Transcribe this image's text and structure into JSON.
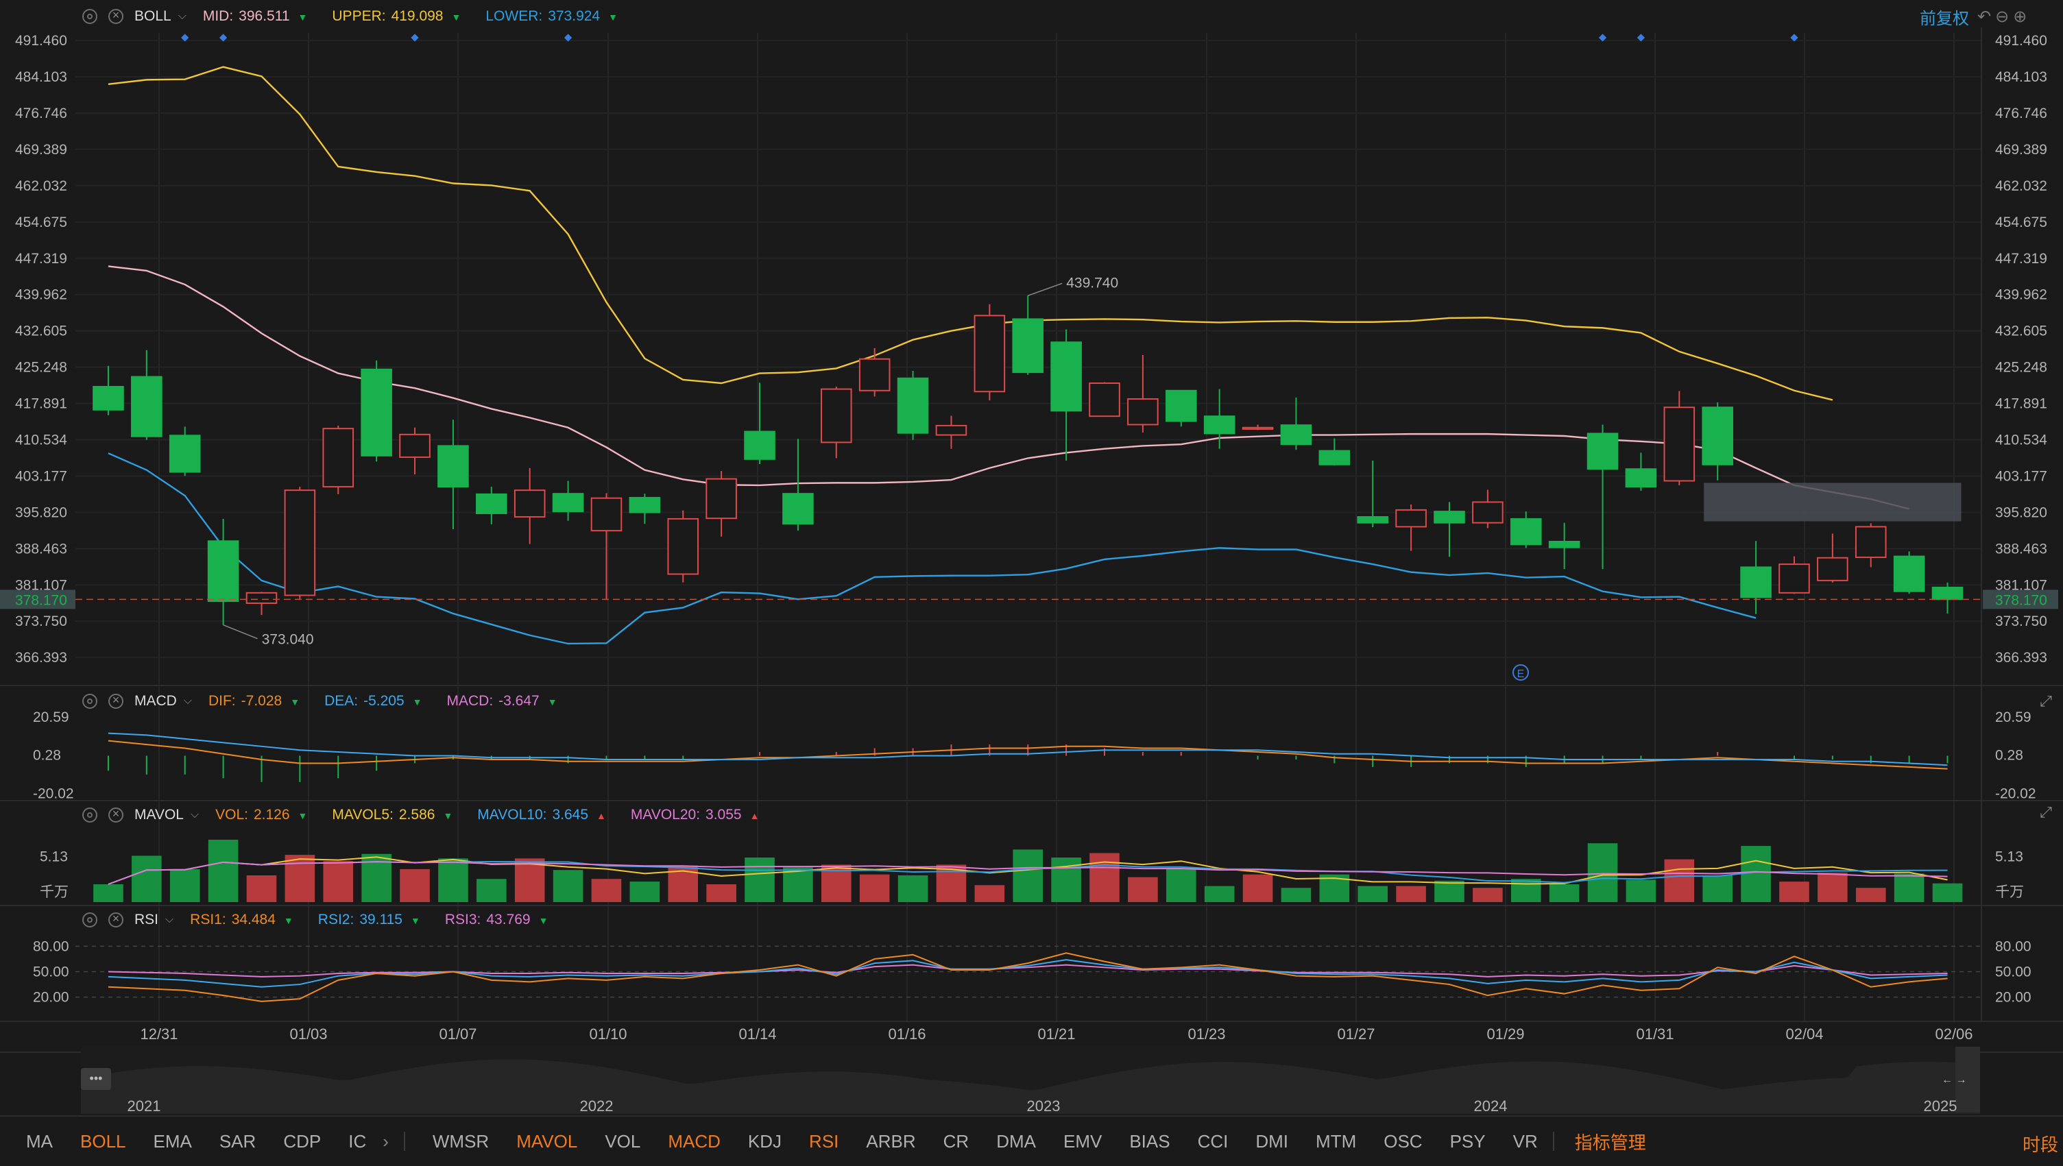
{
  "colors": {
    "up": "#e0484a",
    "down": "#19b14d",
    "mid": "#f2b6c2",
    "upper": "#f2c63a",
    "lower": "#2e9fe0",
    "accent": "#f07a1f",
    "rsi1": "#f08a24",
    "rsi2": "#3ea8f0",
    "rsi3": "#e07ad6"
  },
  "panels": {
    "boll": {
      "name": "BOLL",
      "items": [
        {
          "label": "MID:",
          "value": "396.511",
          "color": "#f2b6c2",
          "arrow": "▼",
          "arrow_color": "#19b14d"
        },
        {
          "label": "UPPER:",
          "value": "419.098",
          "color": "#f2c63a",
          "arrow": "▼",
          "arrow_color": "#19b14d"
        },
        {
          "label": "LOWER:",
          "value": "373.924",
          "color": "#2e9fe0",
          "arrow": "▼",
          "arrow_color": "#19b14d"
        }
      ]
    },
    "macd": {
      "name": "MACD",
      "items": [
        {
          "label": "DIF:",
          "value": "-7.028",
          "color": "#f08a24",
          "arrow": "▼",
          "arrow_color": "#19b14d"
        },
        {
          "label": "DEA:",
          "value": "-5.205",
          "color": "#3ea8f0",
          "arrow": "▼",
          "arrow_color": "#19b14d"
        },
        {
          "label": "MACD:",
          "value": "-3.647",
          "color": "#e07ad6",
          "arrow": "▼",
          "arrow_color": "#19b14d"
        }
      ]
    },
    "mavol": {
      "name": "MAVOL",
      "items": [
        {
          "label": "VOL:",
          "value": "2.126",
          "color": "#f08a24",
          "arrow": "▼",
          "arrow_color": "#19b14d"
        },
        {
          "label": "MAVOL5:",
          "value": "2.586",
          "color": "#f2c63a",
          "arrow": "▼",
          "arrow_color": "#19b14d"
        },
        {
          "label": "MAVOL10:",
          "value": "3.645",
          "color": "#3ea8f0",
          "arrow": "▲",
          "arrow_color": "#e0484a"
        },
        {
          "label": "MAVOL20:",
          "value": "3.055",
          "color": "#e07ad6",
          "arrow": "▲",
          "arrow_color": "#e0484a"
        }
      ]
    },
    "rsi": {
      "name": "RSI",
      "items": [
        {
          "label": "RSI1:",
          "value": "34.484",
          "color": "#f08a24",
          "arrow": "▼",
          "arrow_color": "#19b14d"
        },
        {
          "label": "RSI2:",
          "value": "39.115",
          "color": "#3ea8f0",
          "arrow": "▼",
          "arrow_color": "#19b14d"
        },
        {
          "label": "RSI3:",
          "value": "43.769",
          "color": "#e07ad6",
          "arrow": "▼",
          "arrow_color": "#19b14d"
        }
      ]
    }
  },
  "fq_label": "前复权",
  "time_label": "时段",
  "indicator_manage": "指标管理",
  "indicator_tabs": [
    {
      "label": "MA",
      "active": false
    },
    {
      "label": "BOLL",
      "active": true
    },
    {
      "label": "EMA",
      "active": false
    },
    {
      "label": "SAR",
      "active": false
    },
    {
      "label": "CDP",
      "active": false
    },
    {
      "label": "IC",
      "active": false
    },
    {
      "label": "WMSR",
      "active": false
    },
    {
      "label": "MAVOL",
      "active": true
    },
    {
      "label": "VOL",
      "active": false
    },
    {
      "label": "MACD",
      "active": true
    },
    {
      "label": "KDJ",
      "active": false
    },
    {
      "label": "RSI",
      "active": true
    },
    {
      "label": "ARBR",
      "active": false
    },
    {
      "label": "CR",
      "active": false
    },
    {
      "label": "DMA",
      "active": false
    },
    {
      "label": "EMV",
      "active": false
    },
    {
      "label": "BIAS",
      "active": false
    },
    {
      "label": "CCI",
      "active": false
    },
    {
      "label": "DMI",
      "active": false
    },
    {
      "label": "MTM",
      "active": false
    },
    {
      "label": "OSC",
      "active": false
    },
    {
      "label": "PSY",
      "active": false
    },
    {
      "label": "VR",
      "active": false
    }
  ],
  "chart_data": {
    "type": "candlestick",
    "price_axis_ticks": [
      "491.460",
      "484.103",
      "476.746",
      "469.389",
      "462.032",
      "454.675",
      "447.319",
      "439.962",
      "432.605",
      "425.248",
      "417.891",
      "410.534",
      "403.177",
      "395.820",
      "388.463",
      "381.107",
      "373.750",
      "366.393"
    ],
    "price_range": [
      361,
      493
    ],
    "last_price": "378.170",
    "max_annotation": "439.740",
    "min_annotation": "373.040",
    "event_marker": "E",
    "x_labels": [
      "12/31",
      "01/03",
      "01/07",
      "01/10",
      "01/14",
      "01/16",
      "01/21",
      "01/23",
      "01/27",
      "01/29",
      "01/31",
      "02/04",
      "02/06"
    ],
    "overview_years": [
      "2021",
      "2022",
      "2023",
      "2024",
      "2025"
    ],
    "candles": [
      {
        "o": 421.3,
        "c": 416.6,
        "h": 425.5,
        "l": 415.5
      },
      {
        "o": 423.3,
        "c": 411.2,
        "h": 428.7,
        "l": 410.5
      },
      {
        "o": 411.4,
        "c": 404.0,
        "h": 413.2,
        "l": 403.2
      },
      {
        "o": 390.0,
        "c": 377.8,
        "h": 394.5,
        "l": 373.0
      },
      {
        "o": 377.4,
        "c": 379.5,
        "h": 379.7,
        "l": 375.0
      },
      {
        "o": 379.0,
        "c": 400.3,
        "h": 401.0,
        "l": 378.3
      },
      {
        "o": 401.0,
        "c": 412.8,
        "h": 413.4,
        "l": 399.5
      },
      {
        "o": 424.8,
        "c": 407.3,
        "h": 426.6,
        "l": 406.1
      },
      {
        "o": 407.0,
        "c": 411.6,
        "h": 413.0,
        "l": 403.5
      },
      {
        "o": 409.3,
        "c": 401.0,
        "h": 414.6,
        "l": 392.4
      },
      {
        "o": 399.5,
        "c": 395.6,
        "h": 401.0,
        "l": 393.4
      },
      {
        "o": 394.9,
        "c": 400.3,
        "h": 404.8,
        "l": 389.4
      },
      {
        "o": 399.6,
        "c": 396.0,
        "h": 402.2,
        "l": 394.1
      },
      {
        "o": 392.1,
        "c": 398.7,
        "h": 399.7,
        "l": 378.3
      },
      {
        "o": 398.8,
        "c": 395.8,
        "h": 399.6,
        "l": 393.5
      },
      {
        "o": 383.3,
        "c": 394.5,
        "h": 396.2,
        "l": 381.6
      },
      {
        "o": 394.6,
        "c": 402.6,
        "h": 404.2,
        "l": 390.9
      },
      {
        "o": 412.2,
        "c": 406.6,
        "h": 422.1,
        "l": 405.6
      },
      {
        "o": 399.6,
        "c": 393.5,
        "h": 410.7,
        "l": 392.1
      },
      {
        "o": 410.0,
        "c": 420.8,
        "h": 421.3,
        "l": 406.8
      },
      {
        "o": 420.5,
        "c": 426.9,
        "h": 429.1,
        "l": 419.3
      },
      {
        "o": 423.0,
        "c": 411.9,
        "h": 424.5,
        "l": 410.5
      },
      {
        "o": 411.5,
        "c": 413.4,
        "h": 415.4,
        "l": 408.7
      },
      {
        "o": 420.3,
        "c": 435.7,
        "h": 438.0,
        "l": 418.5
      },
      {
        "o": 435.0,
        "c": 424.2,
        "h": 439.74,
        "l": 423.7
      },
      {
        "o": 430.3,
        "c": 416.4,
        "h": 432.9,
        "l": 406.3
      },
      {
        "o": 415.3,
        "c": 422.0,
        "h": 422.2,
        "l": 415.3
      },
      {
        "o": 413.6,
        "c": 418.8,
        "h": 427.7,
        "l": 412.0
      },
      {
        "o": 420.5,
        "c": 414.3,
        "h": 420.5,
        "l": 413.2
      },
      {
        "o": 415.3,
        "c": 411.8,
        "h": 420.8,
        "l": 408.7
      },
      {
        "o": 412.7,
        "c": 413.0,
        "h": 413.6,
        "l": 412.5
      },
      {
        "o": 413.5,
        "c": 409.6,
        "h": 419.1,
        "l": 408.5
      },
      {
        "o": 408.3,
        "c": 405.5,
        "h": 410.8,
        "l": 405.3
      },
      {
        "o": 394.9,
        "c": 393.7,
        "h": 406.3,
        "l": 392.8
      },
      {
        "o": 392.9,
        "c": 396.3,
        "h": 397.4,
        "l": 388.0
      },
      {
        "o": 396.0,
        "c": 393.7,
        "h": 397.9,
        "l": 386.8
      },
      {
        "o": 393.7,
        "c": 397.9,
        "h": 400.4,
        "l": 392.6
      },
      {
        "o": 394.5,
        "c": 389.3,
        "h": 396.0,
        "l": 388.6
      },
      {
        "o": 389.9,
        "c": 388.7,
        "h": 393.7,
        "l": 384.3
      },
      {
        "o": 411.8,
        "c": 404.6,
        "h": 413.6,
        "l": 384.3
      },
      {
        "o": 404.6,
        "c": 401.0,
        "h": 407.9,
        "l": 400.2
      },
      {
        "o": 402.2,
        "c": 417.1,
        "h": 420.4,
        "l": 401.3
      },
      {
        "o": 417.1,
        "c": 405.5,
        "h": 418.1,
        "l": 402.3
      },
      {
        "o": 384.7,
        "c": 378.6,
        "h": 390.0,
        "l": 375.2
      },
      {
        "o": 379.5,
        "c": 385.3,
        "h": 386.9,
        "l": 379.3
      },
      {
        "o": 382.0,
        "c": 386.6,
        "h": 391.5,
        "l": 381.6
      },
      {
        "o": 386.7,
        "c": 392.9,
        "h": 393.6,
        "l": 384.7
      },
      {
        "o": 386.9,
        "c": 379.8,
        "h": 387.9,
        "l": 379.3
      },
      {
        "o": 380.6,
        "c": 378.2,
        "h": 381.6,
        "l": 375.3
      }
    ],
    "boll_mid": [
      445.7,
      444.8,
      442.0,
      437.5,
      432.1,
      427.5,
      424.0,
      422.3,
      421.0,
      419.0,
      416.8,
      415.0,
      413.0,
      409.0,
      404.4,
      402.5,
      401.4,
      401.3,
      401.7,
      401.8,
      401.8,
      402.0,
      402.4,
      404.8,
      406.8,
      407.9,
      408.7,
      409.3,
      409.6,
      410.9,
      411.2,
      411.5,
      411.5,
      411.6,
      411.7,
      411.7,
      411.7,
      411.5,
      411.3,
      410.6,
      410.2,
      409.7,
      408.4,
      404.8,
      401.3,
      399.9,
      398.5,
      396.5
    ],
    "boll_upper": [
      482.6,
      483.5,
      483.6,
      486.1,
      484.2,
      476.5,
      465.9,
      464.8,
      464.0,
      462.5,
      462.1,
      461.0,
      452.2,
      438.4,
      427.0,
      422.7,
      422.0,
      424.0,
      424.2,
      425.0,
      427.6,
      430.8,
      432.6,
      434.0,
      434.7,
      434.9,
      435.0,
      434.9,
      434.5,
      434.3,
      434.5,
      434.6,
      434.4,
      434.4,
      434.6,
      435.2,
      435.3,
      434.7,
      433.5,
      433.2,
      432.2,
      428.4,
      426.0,
      423.5,
      420.5,
      418.6
    ],
    "boll_lower": [
      407.8,
      404.4,
      399.2,
      388.8,
      382.0,
      379.5,
      380.8,
      378.7,
      378.3,
      375.3,
      373.1,
      370.9,
      369.2,
      369.3,
      375.5,
      376.5,
      379.6,
      379.4,
      378.2,
      378.9,
      382.7,
      382.9,
      383.0,
      383.0,
      383.2,
      384.4,
      386.3,
      387.0,
      387.9,
      388.6,
      388.3,
      388.3,
      386.7,
      385.3,
      383.7,
      383.1,
      383.5,
      382.6,
      382.8,
      379.8,
      378.6,
      378.7,
      376.5,
      374.4
    ],
    "macd_axis": [
      "20.59",
      "0.28",
      "-20.02"
    ],
    "macd_range": [
      -21,
      21
    ],
    "dif": [
      8,
      6,
      4,
      1,
      -2,
      -4,
      -4,
      -3,
      -2,
      -1,
      -2,
      -2,
      -3,
      -3,
      -3,
      -3,
      -2,
      -1,
      -1,
      0,
      1,
      2,
      3,
      4,
      4,
      5,
      5,
      4,
      4,
      3,
      2,
      1,
      -1,
      -2,
      -3,
      -3,
      -3,
      -4,
      -4,
      -4,
      -3,
      -2,
      -1,
      -2,
      -3,
      -4,
      -5,
      -6,
      -7
    ],
    "dea": [
      12,
      11,
      9,
      7,
      5,
      3,
      2,
      1,
      0,
      0,
      -1,
      -1,
      -1,
      -2,
      -2,
      -2,
      -2,
      -2,
      -1,
      -1,
      -1,
      0,
      0,
      1,
      1,
      2,
      3,
      3,
      3,
      3,
      3,
      2,
      1,
      1,
      0,
      -1,
      -1,
      -1,
      -2,
      -2,
      -2,
      -2,
      -2,
      -2,
      -2,
      -3,
      -3,
      -4,
      -5
    ],
    "vol_axis": [
      "5.13",
      "千万"
    ],
    "vol_max": 7.0,
    "volumes": [
      2.0,
      5.2,
      3.7,
      7.0,
      3.0,
      5.3,
      4.6,
      5.4,
      3.7,
      4.9,
      2.6,
      4.9,
      3.6,
      2.6,
      2.3,
      4.1,
      2.0,
      5.0,
      3.9,
      4.2,
      3.1,
      3.0,
      4.2,
      1.9,
      5.9,
      5.0,
      5.5,
      2.8,
      3.8,
      1.8,
      3.1,
      1.6,
      3.1,
      1.8,
      1.8,
      2.4,
      1.6,
      2.6,
      2.0,
      6.6,
      2.5,
      4.8,
      3.0,
      6.3,
      2.3,
      3.3,
      1.6,
      3.2,
      2.1
    ],
    "rsi_axis": [
      "80.00",
      "50.00",
      "20.00"
    ],
    "rsi1": [
      32,
      30,
      28,
      22,
      15,
      18,
      40,
      48,
      45,
      50,
      40,
      38,
      42,
      40,
      44,
      42,
      48,
      52,
      58,
      45,
      65,
      70,
      52,
      52,
      60,
      72,
      62,
      53,
      55,
      58,
      52,
      45,
      44,
      45,
      40,
      35,
      22,
      30,
      24,
      34,
      28,
      30,
      55,
      48,
      68,
      52,
      32,
      38,
      42,
      48,
      36,
      35
    ],
    "rsi2": [
      44,
      42,
      40,
      36,
      32,
      35,
      45,
      48,
      47,
      50,
      45,
      44,
      46,
      45,
      46,
      45,
      48,
      50,
      54,
      47,
      60,
      63,
      53,
      53,
      57,
      64,
      58,
      53,
      54,
      55,
      52,
      48,
      47,
      47,
      45,
      42,
      36,
      40,
      38,
      42,
      38,
      40,
      52,
      50,
      61,
      52,
      42,
      44,
      46,
      48,
      42,
      39
    ],
    "rsi3": [
      50,
      49,
      48,
      46,
      44,
      45,
      48,
      49,
      49,
      50,
      48,
      48,
      49,
      48,
      48,
      48,
      49,
      50,
      52,
      49,
      56,
      58,
      53,
      53,
      55,
      58,
      55,
      52,
      53,
      53,
      51,
      49,
      49,
      49,
      48,
      47,
      44,
      46,
      45,
      47,
      45,
      46,
      51,
      50,
      57,
      52,
      46,
      47,
      48,
      49,
      46,
      44
    ]
  }
}
